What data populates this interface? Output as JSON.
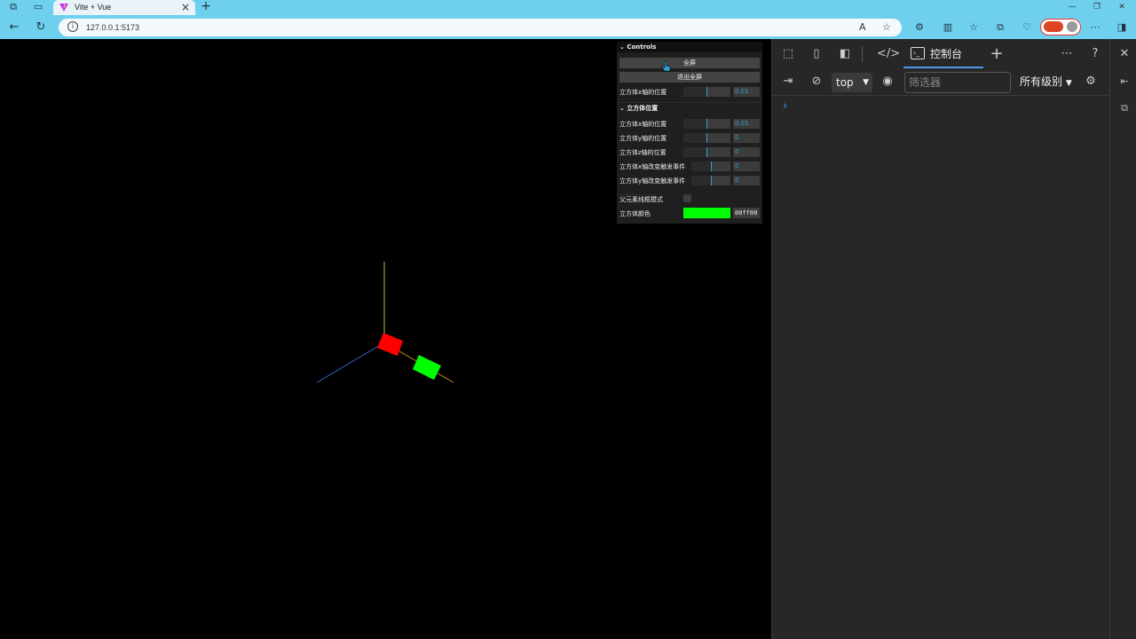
{
  "browser": {
    "tab_title": "Vite + Vue",
    "tab_close": "×",
    "new_tab": "+",
    "url": "127.0.0.1:5173",
    "profile_badge": "​",
    "window_minimize": "—",
    "window_restore": "❐",
    "window_close": "✕"
  },
  "gui": {
    "title": "Controls",
    "fullscreen_button": "全屏",
    "exit_fullscreen_button": "退出全屏",
    "x_position_label": "立方体x轴的位置",
    "x_position_value": "0.01",
    "folder_title": "立方体位置",
    "folder_rows": [
      {
        "label": "立方体x轴的位置",
        "value": "0.01"
      },
      {
        "label": "立方体y轴的位置",
        "value": "0"
      },
      {
        "label": "立方体z轴的位置",
        "value": "0"
      },
      {
        "label": "立方体x轴改变触发事件",
        "value": "0"
      },
      {
        "label": "立方体y轴改变触发事件",
        "value": "0"
      }
    ],
    "wireframe_label": "父元素线框模式",
    "color_label": "立方体颜色",
    "color_value": "00ff00",
    "color_swatch": "#00ff00"
  },
  "devtools": {
    "console_tab_label": "控制台",
    "context_select": "top",
    "filter_placeholder": "筛选器",
    "levels_label": "所有级别",
    "prompt_symbol": "›"
  },
  "scene": {
    "cube_colors": {
      "red": "#ff0000",
      "green": "#00ff00"
    }
  }
}
